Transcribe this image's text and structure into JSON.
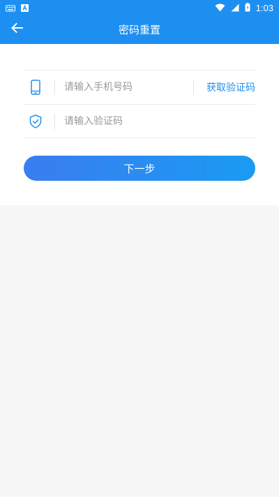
{
  "status_bar": {
    "time": "1:03",
    "left_icons": [
      "keyboard-icon",
      "notification-a-icon"
    ],
    "right_icons": [
      "wifi-icon",
      "signal-icon",
      "battery-icon"
    ]
  },
  "header": {
    "title": "密码重置",
    "back_icon": "arrow-left-icon"
  },
  "form": {
    "phone": {
      "placeholder": "请输入手机号码",
      "value": "",
      "icon": "phone-icon"
    },
    "code": {
      "placeholder": "请输入验证码",
      "value": "",
      "icon": "shield-check-icon"
    },
    "get_code_label": "获取验证码",
    "next_label": "下一步"
  },
  "colors": {
    "primary": "#1d8ff0",
    "button_gradient_start": "#3a7df0",
    "button_gradient_end": "#1a9bf3",
    "background": "#f7f7f7"
  }
}
